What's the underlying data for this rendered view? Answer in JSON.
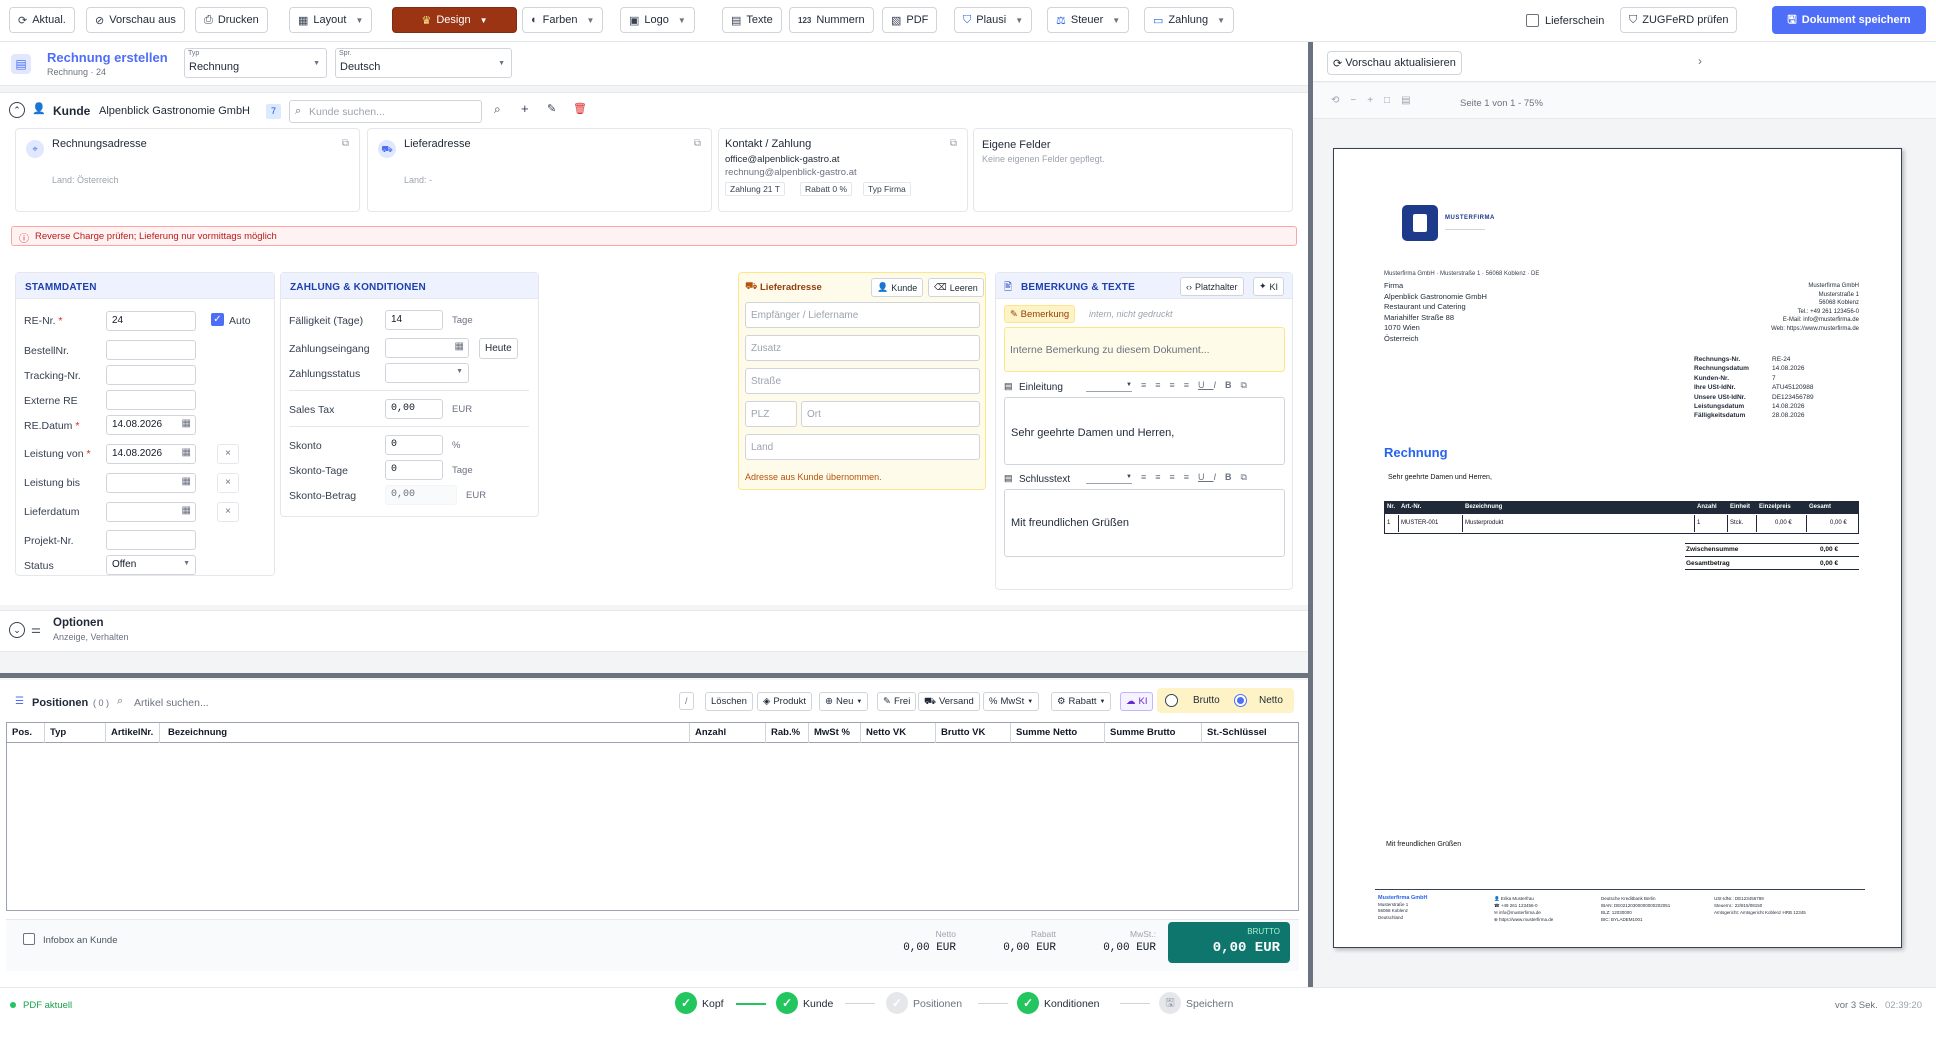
{
  "toolbar": {
    "refresh": "Aktual.",
    "preview_off": "Vorschau aus",
    "print": "Drucken",
    "layout": "Layout",
    "design": "Design",
    "colors": "Farben",
    "logo": "Logo",
    "texts": "Texte",
    "numbers": "Nummern",
    "pdf": "PDF",
    "plausi": "Plausi",
    "tax": "Steuer",
    "payment": "Zahlung",
    "delivery_note": "Lieferschein",
    "zugferd": "ZUGFeRD prüfen",
    "save": "Dokument speichern",
    "accent": "#9a3412",
    "primary": "#4f6ef7"
  },
  "header": {
    "title": "Rechnung erstellen",
    "subtitle": "Rechnung · 24",
    "type_label": "Typ",
    "type_value": "Rechnung",
    "lang_label": "Spr.",
    "lang_value": "Deutsch"
  },
  "customer": {
    "label": "Kunde",
    "name": "Alpenblick Gastronomie GmbH",
    "count": "7",
    "search_placeholder": "Kunde suchen..."
  },
  "address_cards": {
    "billing_title": "Rechnungsadresse",
    "billing_land": "Land: Österreich",
    "delivery_title": "Lieferadresse",
    "delivery_land": "Land: -",
    "contact_title": "Kontakt / Zahlung",
    "email1": "office@alpenblick-gastro.at",
    "email2": "rechnung@alpenblick-gastro.at",
    "chip_payment": "Zahlung 21 T",
    "chip_discount": "Rabatt 0 %",
    "chip_type": "Typ Firma",
    "custom_title": "Eigene Felder",
    "custom_text": "Keine eigenen Felder gepflegt."
  },
  "warning": "Reverse Charge prüfen; Lieferung nur vormittags möglich",
  "stammdaten": {
    "title": "STAMMDATEN",
    "re_nr_label": "RE-Nr.",
    "re_nr": "24",
    "auto": "Auto",
    "bestell_label": "BestellNr.",
    "tracking_label": "Tracking-Nr.",
    "extern_label": "Externe RE",
    "datum_label": "RE.Datum",
    "datum": "14.08.2026",
    "leistung_von_label": "Leistung von",
    "leistung_von": "14.08.2026",
    "leistung_bis_label": "Leistung bis",
    "lieferdatum_label": "Lieferdatum",
    "projekt_label": "Projekt-Nr.",
    "status_label": "Status",
    "status": "Offen"
  },
  "zahlung": {
    "title": "ZAHLUNG & KONDITIONEN",
    "faellig_label": "Fälligkeit (Tage)",
    "faellig": "14",
    "tage": "Tage",
    "eingang_label": "Zahlungseingang",
    "heute": "Heute",
    "status_label": "Zahlungsstatus",
    "sales_tax_label": "Sales Tax",
    "sales_tax": "0,00",
    "eur": "EUR",
    "skonto_label": "Skonto",
    "skonto": "0",
    "pct": "%",
    "skonto_tage_label": "Skonto-Tage",
    "skonto_tage": "0",
    "tage2": "Tage",
    "skonto_betrag_label": "Skonto-Betrag",
    "skonto_betrag": "0,00",
    "eur2": "EUR"
  },
  "liefer": {
    "title": "Lieferadresse",
    "kunde_btn": "Kunde",
    "leeren_btn": "Leeren",
    "empfaenger_ph": "Empfänger / Liefername",
    "zusatz_ph": "Zusatz",
    "strasse_ph": "Straße",
    "plz_ph": "PLZ",
    "ort_ph": "Ort",
    "land_ph": "Land",
    "hint": "Adresse aus Kunde übernommen."
  },
  "bemerkung": {
    "title": "BEMERKUNG & TEXTE",
    "platzhalter": "Platzhalter",
    "ki": "KI",
    "tab": "Bemerkung",
    "tab_hint": "intern, nicht gedruckt",
    "internal_ph": "Interne Bemerkung zu diesem Dokument...",
    "einleitung_label": "Einleitung",
    "einleitung_text": "Sehr geehrte Damen und Herren,",
    "schluss_label": "Schlusstext",
    "schluss_text": "Mit freundlichen Grüßen"
  },
  "optionen": {
    "title": "Optionen",
    "subtitle": "Anzeige, Verhalten"
  },
  "positionen": {
    "title": "Positionen",
    "count": "( 0 )",
    "search_ph": "Artikel suchen...",
    "slash": "/",
    "loeschen": "Löschen",
    "produkt": "Produkt",
    "neu": "Neu",
    "frei": "Frei",
    "versand": "Versand",
    "mwst": "MwSt",
    "rabatt": "Rabatt",
    "ki": "KI",
    "brutto": "Brutto",
    "netto": "Netto",
    "columns": [
      "Pos.",
      "Typ",
      "ArtikelNr.",
      "Bezeichnung",
      "Anzahl",
      "Rab.%",
      "MwSt %",
      "Netto VK",
      "Brutto VK",
      "Summe Netto",
      "Summe Brutto",
      "St.-Schlüssel"
    ]
  },
  "totals": {
    "infobox": "Infobox an Kunde",
    "netto_label": "Netto",
    "netto": "0,00 EUR",
    "rabatt_label": "Rabatt",
    "rabatt": "0,00 EUR",
    "mwst_label": "MwSt.:",
    "mwst": "0,00 EUR",
    "brutto_label": "BRUTTO",
    "brutto": "0,00 EUR"
  },
  "statusbar": {
    "pdf_status": "PDF aktuell",
    "steps": [
      "Kopf",
      "Kunde",
      "Positionen",
      "Konditionen",
      "Speichern"
    ],
    "saved": "vor 3 Sek.",
    "time": "02:39:20"
  },
  "preview": {
    "update_btn": "Vorschau aktualisieren",
    "page_info": "Seite 1 von 1 - 75%",
    "logo_text": "MUSTERFIRMA",
    "sender_line": "Musterfirma GmbH · Musterstraße 1 · 56068 Koblenz · DE",
    "recipient": [
      "Firma",
      "Alpenblick Gastronomie GmbH",
      "Restaurant und Catering",
      "Mariahilfer Straße 88",
      "1070 Wien",
      "Österreich"
    ],
    "company_block": [
      "Musterfirma GmbH",
      "Musterstraße 1",
      "56068 Koblenz",
      "Tel.: +49 261 123456-0",
      "E-Mail: info@musterfirma.de",
      "Web: https://www.musterfirma.de"
    ],
    "meta": [
      {
        "k": "Rechnungs-Nr.",
        "v": "RE-24"
      },
      {
        "k": "Rechnungsdatum",
        "v": "14.08.2026"
      },
      {
        "k": "Kunden-Nr.",
        "v": "7"
      },
      {
        "k": "Ihre USt-IdNr.",
        "v": "ATU45120988"
      },
      {
        "k": "Unsere USt-IdNr.",
        "v": "DE123456789"
      },
      {
        "k": "Leistungsdatum",
        "v": "14.08.2026"
      },
      {
        "k": "Fälligkeitsdatum",
        "v": "28.08.2026"
      }
    ],
    "doc_title": "Rechnung",
    "greeting": "Sehr geehrte Damen und Herren,",
    "table_head": [
      "Nr.",
      "Art.-Nr.",
      "Bezeichnung",
      "Anzahl",
      "Einheit",
      "Einzelpreis",
      "Gesamt"
    ],
    "table_row": [
      "1",
      "MUSTER-001",
      "Musterprodukt",
      "1",
      "Stck.",
      "0,00 €",
      "0,00 €"
    ],
    "subtotal_label": "Zwischensumme",
    "subtotal": "0,00 €",
    "total_label": "Gesamtbetrag",
    "total": "0,00 €",
    "closing": "Mit freundlichen Grüßen",
    "footer_col1": [
      "Musterfirma GmbH",
      "Musterstraße 1",
      "56068 Koblenz",
      "Deutschland"
    ],
    "footer_col2": [
      "Erika Musterfrau",
      "+49 261 123456-0",
      "info@musterfirma.de",
      "https://www.musterfirma.de"
    ],
    "footer_col3": [
      "Deutsche Kreditbank Berlin",
      "IBAN: DE02120300000000202051",
      "BLZ: 12030000",
      "BIC: BYLADEM1001"
    ],
    "footer_col4": [
      "USt-IdNr.: DE123456789",
      "Steuernr.: 22/815/08150",
      "Amtsgericht: Amtsgericht Koblenz HRB 12345"
    ]
  }
}
